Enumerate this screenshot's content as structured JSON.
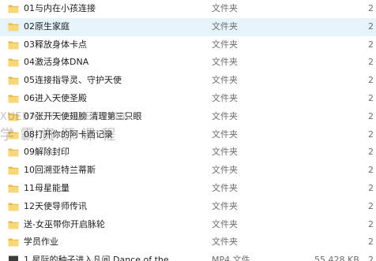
{
  "files": [
    {
      "name": "01与内在小孩连接",
      "type": "文件夹",
      "size": "",
      "date": "2",
      "kind": "folder"
    },
    {
      "name": "02原生家庭",
      "type": "文件夹",
      "size": "",
      "date": "2",
      "kind": "folder",
      "hover": true
    },
    {
      "name": "03释放身体卡点",
      "type": "文件夹",
      "size": "",
      "date": "2",
      "kind": "folder"
    },
    {
      "name": "04激活身体DNA",
      "type": "文件夹",
      "size": "",
      "date": "2",
      "kind": "folder"
    },
    {
      "name": "05连接指导灵、守护天使",
      "type": "文件夹",
      "size": "",
      "date": "2",
      "kind": "folder"
    },
    {
      "name": "06进入天使圣殿",
      "type": "文件夹",
      "size": "",
      "date": "2",
      "kind": "folder"
    },
    {
      "name": "07张开天使翅膀 清理第三只眼",
      "type": "文件夹",
      "size": "",
      "date": "2",
      "kind": "folder"
    },
    {
      "name": "08打开你的阿卡西记录",
      "type": "文件夹",
      "size": "",
      "date": "2",
      "kind": "folder"
    },
    {
      "name": "09解除封印",
      "type": "文件夹",
      "size": "",
      "date": "2",
      "kind": "folder"
    },
    {
      "name": "10回溯亚特兰蒂斯",
      "type": "文件夹",
      "size": "",
      "date": "2",
      "kind": "folder"
    },
    {
      "name": "11母星能量",
      "type": "文件夹",
      "size": "",
      "date": "2",
      "kind": "folder"
    },
    {
      "name": "12天使导师传讯",
      "type": "文件夹",
      "size": "",
      "date": "2",
      "kind": "folder"
    },
    {
      "name": "送-女巫带你开启脉轮",
      "type": "文件夹",
      "size": "",
      "date": "2",
      "kind": "folder"
    },
    {
      "name": "学员作业",
      "type": "文件夹",
      "size": "",
      "date": "2",
      "kind": "folder"
    },
    {
      "name": "1 星际的种子进入凡间  Dance of the",
      "type": "MP4 文件",
      "size": "55,428 KB",
      "date": "2",
      "kind": "video",
      "partial": true
    }
  ],
  "watermark": {
    "line1": "XUEBAZIYUANKECHENG",
    "line2": "学 霸 资 源 课 程"
  },
  "colors": {
    "folder_back": "#e8b64a",
    "folder_front": "#f8d775",
    "hover_bg": "#e5f3fb",
    "secondary_text": "#6d6d6d"
  }
}
